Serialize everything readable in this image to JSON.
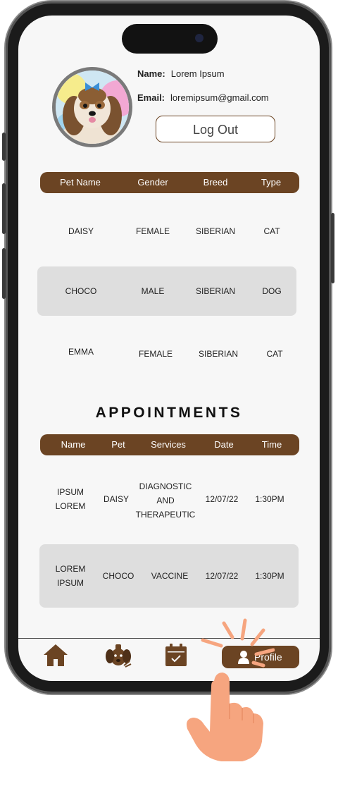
{
  "user": {
    "name_label": "Name:",
    "name_value": "Lorem Ipsum",
    "email_label": "Email:",
    "email_value": "loremipsum@gmail.com",
    "logout_label": "Log Out"
  },
  "pets_table": {
    "headers": [
      "Pet Name",
      "Gender",
      "Breed",
      "Type"
    ],
    "rows": [
      [
        "DAISY",
        "FEMALE",
        "SIBERIAN",
        "CAT"
      ],
      [
        "CHOCO",
        "MALE",
        "SIBERIAN",
        "DOG"
      ],
      [
        "EMMA",
        "FEMALE",
        "SIBERIAN",
        "CAT"
      ]
    ]
  },
  "appointments": {
    "title": "APPOINTMENTS",
    "headers": [
      "Name",
      "Pet",
      "Services",
      "Date",
      "Time"
    ],
    "rows": [
      {
        "name_line1": "IPSUM",
        "name_line2": "LOREM",
        "pet": "DAISY",
        "service_line1": "DIAGNOSTIC",
        "service_line2": "AND",
        "service_line3": "THERAPEUTIC",
        "date": "12/07/22",
        "time": "1:30PM"
      },
      {
        "name_line1": "LOREM",
        "name_line2": "IPSUM",
        "pet": "CHOCO",
        "service_line1": "VACCINE",
        "date": "12/07/22",
        "time": "1:30PM"
      }
    ]
  },
  "nav": {
    "items": [
      {
        "icon": "home-icon"
      },
      {
        "icon": "pet-icon"
      },
      {
        "icon": "calendar-icon"
      },
      {
        "icon": "profile-icon",
        "label": "Profile",
        "active": true
      }
    ]
  },
  "colors": {
    "brand_brown": "#6b4423",
    "shaded_row": "#dedede",
    "hand_skin": "#f6a57f"
  }
}
